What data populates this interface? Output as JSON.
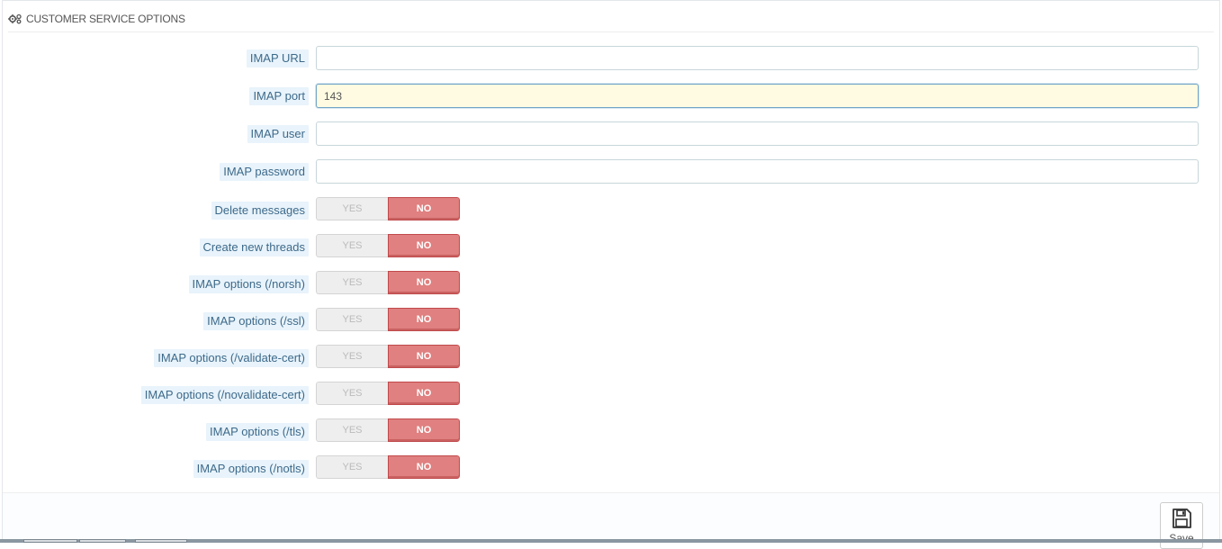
{
  "panel": {
    "title": "CUSTOMER SERVICE OPTIONS",
    "icon": "cogs-icon"
  },
  "fields": {
    "imap_url": {
      "label": "IMAP URL",
      "value": ""
    },
    "imap_port": {
      "label": "IMAP port",
      "value": "143"
    },
    "imap_user": {
      "label": "IMAP user",
      "value": ""
    },
    "imap_password": {
      "label": "IMAP password",
      "value": ""
    }
  },
  "switches": [
    {
      "label": "Delete messages",
      "yes": "YES",
      "no": "NO",
      "selected": "NO"
    },
    {
      "label": "Create new threads",
      "yes": "YES",
      "no": "NO",
      "selected": "NO"
    },
    {
      "label": "IMAP options (/norsh)",
      "yes": "YES",
      "no": "NO",
      "selected": "NO"
    },
    {
      "label": "IMAP options (/ssl)",
      "yes": "YES",
      "no": "NO",
      "selected": "NO"
    },
    {
      "label": "IMAP options (/validate-cert)",
      "yes": "YES",
      "no": "NO",
      "selected": "NO"
    },
    {
      "label": "IMAP options (/novalidate-cert)",
      "yes": "YES",
      "no": "NO",
      "selected": "NO"
    },
    {
      "label": "IMAP options (/tls)",
      "yes": "YES",
      "no": "NO",
      "selected": "NO"
    },
    {
      "label": "IMAP options (/notls)",
      "yes": "YES",
      "no": "NO",
      "selected": "NO"
    }
  ],
  "footer": {
    "save_label": "Save",
    "save_icon": "floppy-disk-icon"
  },
  "colors": {
    "label_bg": "#e8f3fb",
    "label_text": "#3e6a8a",
    "no_active": "#e08080",
    "focused_input_bg": "#fefbe2"
  }
}
